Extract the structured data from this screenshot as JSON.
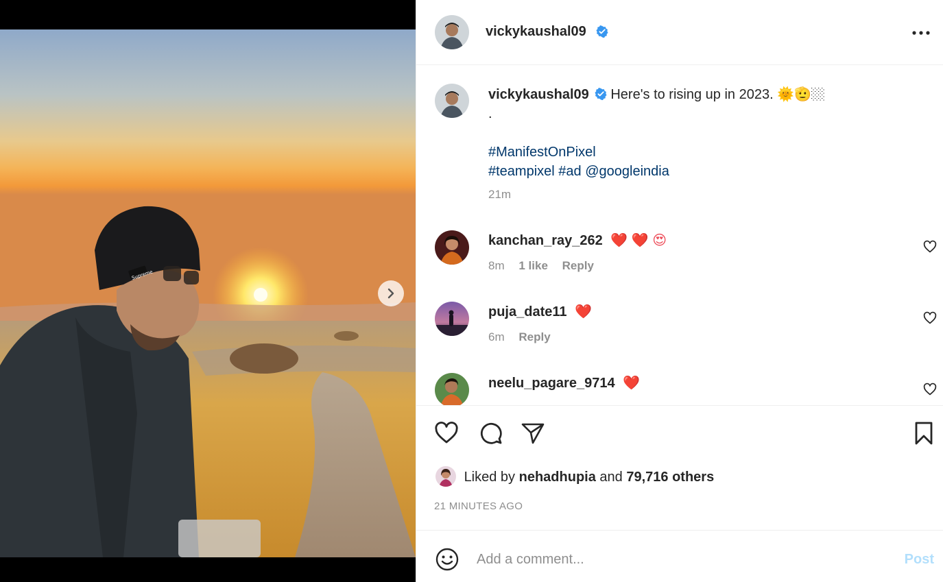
{
  "post": {
    "username": "vickykaushal09",
    "verified": true,
    "caption": "Here's to rising up in 2023. 🌞🫡🏼",
    "caption_dot": ".",
    "hashtags_line1": "#ManifestOnPixel",
    "hashtags_line2_a": "#teampixel",
    "hashtags_line2_b": "#ad",
    "mention": "@googleindia",
    "time": "21m"
  },
  "comments": [
    {
      "username": "kanchan_ray_262",
      "text": "❤️ ❤️ 😍",
      "time": "8m",
      "likes": "1 like",
      "reply": "Reply"
    },
    {
      "username": "puja_date11",
      "text": "❤️",
      "time": "6m",
      "likes": "",
      "reply": "Reply"
    },
    {
      "username": "neelu_pagare_9714",
      "text": "❤️"
    }
  ],
  "likes": {
    "prefix": "Liked by",
    "user": "nehadhupia",
    "joiner": "and",
    "others": "79,716 others",
    "date": "21 MINUTES AGO"
  },
  "composer": {
    "placeholder": "Add a comment...",
    "post_label": "Post"
  },
  "colors": {
    "link": "#00376b",
    "verified": "#3897f0",
    "heart": "#ed4956",
    "post_disabled": "#b2dffc"
  }
}
